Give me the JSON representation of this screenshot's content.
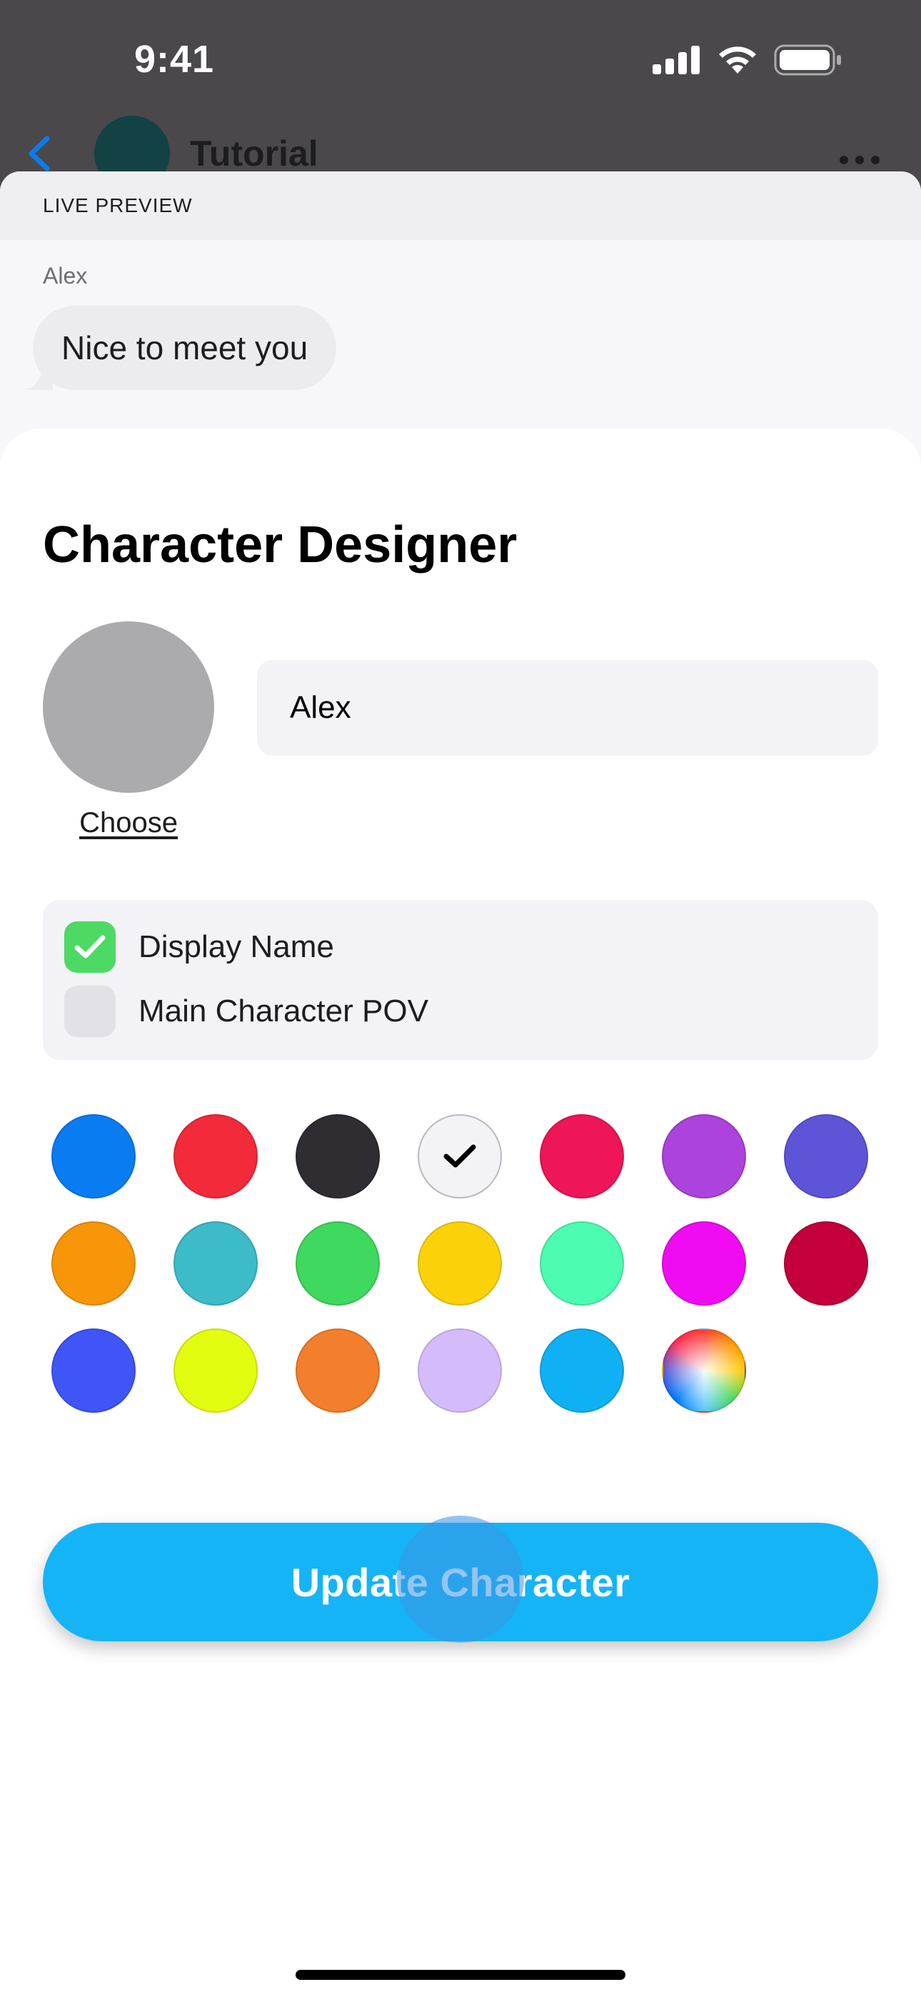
{
  "status_bar": {
    "time": "9:41",
    "icons": [
      "cellular-signal-icon",
      "wifi-icon",
      "battery-icon"
    ]
  },
  "background_header": {
    "title": "Tutorial",
    "back_icon": "chevron-left-icon",
    "more_icon": "ellipsis-icon"
  },
  "preview": {
    "label": "LIVE PREVIEW",
    "sender": "Alex",
    "message": "Nice to meet you"
  },
  "designer": {
    "title": "Character Designer",
    "avatar_action": "Choose",
    "name_value": "Alex",
    "options": [
      {
        "label": "Display Name",
        "checked": true
      },
      {
        "label": "Main Character POV",
        "checked": false
      }
    ],
    "colors": [
      {
        "name": "blue",
        "hex": "#0a7cf2",
        "selected": false
      },
      {
        "name": "red",
        "hex": "#f22a3a",
        "selected": false
      },
      {
        "name": "charcoal",
        "hex": "#2f2d32",
        "selected": false
      },
      {
        "name": "white",
        "hex": "#f3f3f6",
        "selected": true
      },
      {
        "name": "crimson-pink",
        "hex": "#ee1558",
        "selected": false
      },
      {
        "name": "purple",
        "hex": "#ac43dc",
        "selected": false
      },
      {
        "name": "indigo",
        "hex": "#5e54d7",
        "selected": false
      },
      {
        "name": "orange",
        "hex": "#f89609",
        "selected": false
      },
      {
        "name": "teal",
        "hex": "#3dbbc8",
        "selected": false
      },
      {
        "name": "green",
        "hex": "#3ed95e",
        "selected": false
      },
      {
        "name": "yellow",
        "hex": "#fbd20a",
        "selected": false
      },
      {
        "name": "mint",
        "hex": "#4cfcb0",
        "selected": false
      },
      {
        "name": "magenta",
        "hex": "#f00cf2",
        "selected": false
      },
      {
        "name": "maroon",
        "hex": "#c3003c",
        "selected": false
      },
      {
        "name": "royal-blue",
        "hex": "#4055f8",
        "selected": false
      },
      {
        "name": "lime",
        "hex": "#e2fd10",
        "selected": false
      },
      {
        "name": "tangerine",
        "hex": "#f37e2b",
        "selected": false
      },
      {
        "name": "lavender",
        "hex": "#d4bcfb",
        "selected": false
      },
      {
        "name": "sky-blue",
        "hex": "#0fb1f4",
        "selected": false
      },
      {
        "name": "custom-color",
        "hex": "spectrum",
        "selected": false
      }
    ],
    "update_button": "Update Character"
  }
}
